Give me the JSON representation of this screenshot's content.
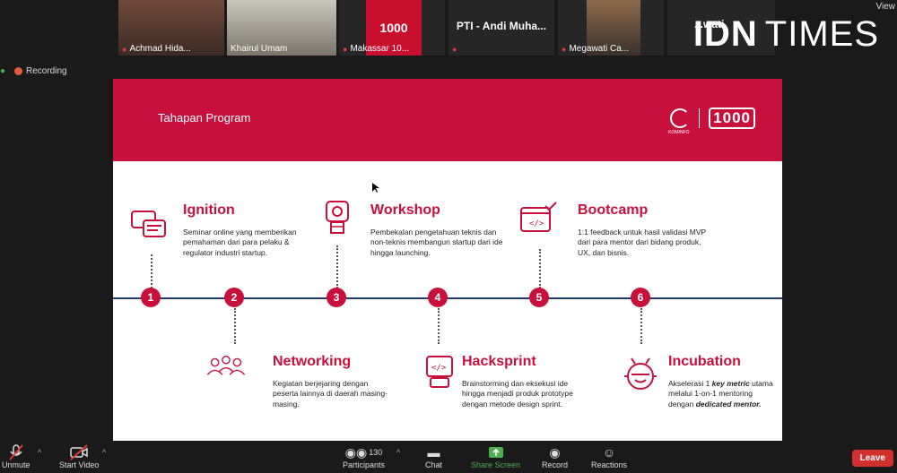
{
  "participants": [
    {
      "name": "Achmad Hida..."
    },
    {
      "name": "Khairul Umam"
    },
    {
      "name": "Makassar 10..."
    },
    {
      "name": "PTI - Andi Muha..."
    },
    {
      "name": "Megawati Ca..."
    },
    {
      "name": "...wati"
    }
  ],
  "brand": {
    "part1": "IDN",
    "part2": "TIMES"
  },
  "view_label": "View",
  "recording_label": "Recording",
  "slide": {
    "title": "Tahapan Program",
    "logo_text": "1000",
    "logo_sub": "KOMINFO",
    "steps": [
      {
        "num": "1",
        "title": "Ignition",
        "desc": "Seminar online yang memberikan pemahaman dari para pelaku & regulator industri startup."
      },
      {
        "num": "2",
        "title": "Networking",
        "desc": "Kegiatan berjejaring dengan peserta lainnya di daerah masing-masing."
      },
      {
        "num": "3",
        "title": "Workshop",
        "desc": "Pembekalan pengetahuan teknis dan non-teknis membangun startup dari ide hingga launching."
      },
      {
        "num": "4",
        "title": "Hacksprint",
        "desc": "Brainstorming dan eksekusi ide hingga menjadi produk prototype dengan metode design sprint."
      },
      {
        "num": "5",
        "title": "Bootcamp",
        "desc": "1:1 feedback untuk hasil validasi MVP dari para mentor dari bidang produk, UX, dan bisnis."
      },
      {
        "num": "6",
        "title": "Incubation",
        "desc_a": "Akselerasi 1 ",
        "desc_b": "key metric",
        "desc_c": " utama melalui 1-on-1 mentoring dengan ",
        "desc_d": "dedicated mentor."
      }
    ]
  },
  "toolbar": {
    "unmute": "Unmute",
    "start_video": "Start Video",
    "participants": "Participants",
    "participants_count": "130",
    "chat": "Chat",
    "share_screen": "Share Screen",
    "record": "Record",
    "reactions": "Reactions",
    "leave": "Leave"
  },
  "colors": {
    "accent": "#c8103c",
    "timeline": "#1f3a6b",
    "share": "#4caf50",
    "leave": "#d0312d"
  }
}
